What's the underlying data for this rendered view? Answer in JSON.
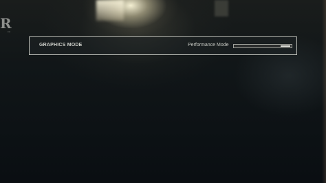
{
  "menu": {
    "logo_text": "R",
    "logo_mark": "™",
    "graphics_mode": {
      "label": "GRAPHICS MODE",
      "value": "Performance Mode",
      "level_fraction": 1.0
    }
  },
  "icons": [
    "game-logo-icon"
  ]
}
